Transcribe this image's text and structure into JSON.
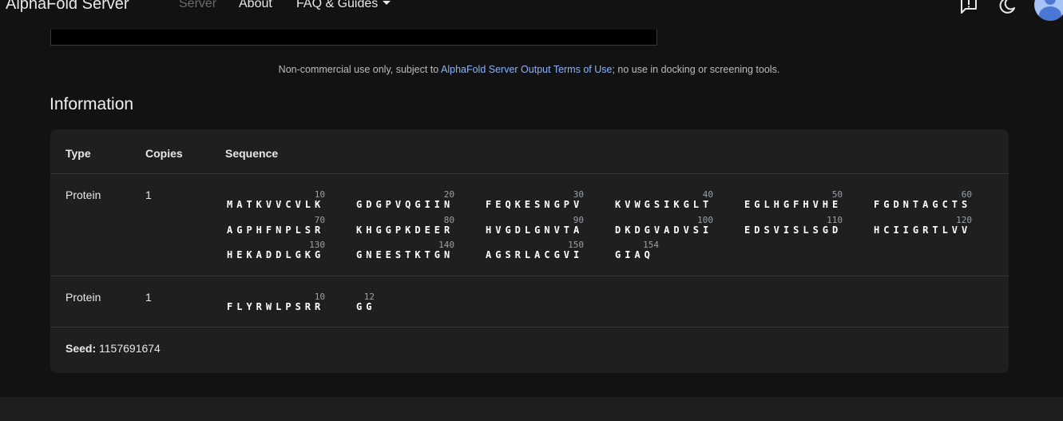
{
  "header": {
    "brand": "AlphaFold Server",
    "nav": {
      "server": "Server",
      "about": "About",
      "faq": "FAQ & Guides"
    }
  },
  "terms": {
    "prefix": "Non-commercial use only, subject to ",
    "link": "AlphaFold Server Output Terms of Use",
    "suffix": "; no use in docking or screening tools."
  },
  "information": {
    "title": "Information",
    "columns": {
      "type": "Type",
      "copies": "Copies",
      "sequence": "Sequence"
    },
    "entities": [
      {
        "type": "Protein",
        "copies": "1",
        "lines": [
          [
            {
              "num": "10",
              "res": "MATKVVCVLK"
            },
            {
              "num": "20",
              "res": "GDGPVQGIIN"
            },
            {
              "num": "30",
              "res": "FEQKESNGPV"
            },
            {
              "num": "40",
              "res": "KVWGSIKGLT"
            },
            {
              "num": "50",
              "res": "EGLHGFHVHE"
            },
            {
              "num": "60",
              "res": "FGDNTAGCTS"
            }
          ],
          [
            {
              "num": "70",
              "res": "AGPHFNPLSR"
            },
            {
              "num": "80",
              "res": "KHGGPKDEER"
            },
            {
              "num": "90",
              "res": "HVGDLGNVTA"
            },
            {
              "num": "100",
              "res": "DKDGVADVSI"
            },
            {
              "num": "110",
              "res": "EDSVISLSGD"
            },
            {
              "num": "120",
              "res": "HCIIGRTLVV"
            }
          ],
          [
            {
              "num": "130",
              "res": "HEKADDLGKG"
            },
            {
              "num": "140",
              "res": "GNEESTKTGN"
            },
            {
              "num": "150",
              "res": "AGSRLACGVI"
            },
            {
              "num": "154",
              "res": "GIAQ"
            }
          ]
        ]
      },
      {
        "type": "Protein",
        "copies": "1",
        "lines": [
          [
            {
              "num": "10",
              "res": "FLYRWLPSRR"
            },
            {
              "num": "12",
              "res": "GG"
            }
          ]
        ]
      }
    ],
    "seed_label": "Seed:",
    "seed_value": "1157691674"
  },
  "icons": {
    "feedback": "feedback-icon",
    "theme": "dark-mode-icon",
    "account": "account-avatar-icon"
  }
}
